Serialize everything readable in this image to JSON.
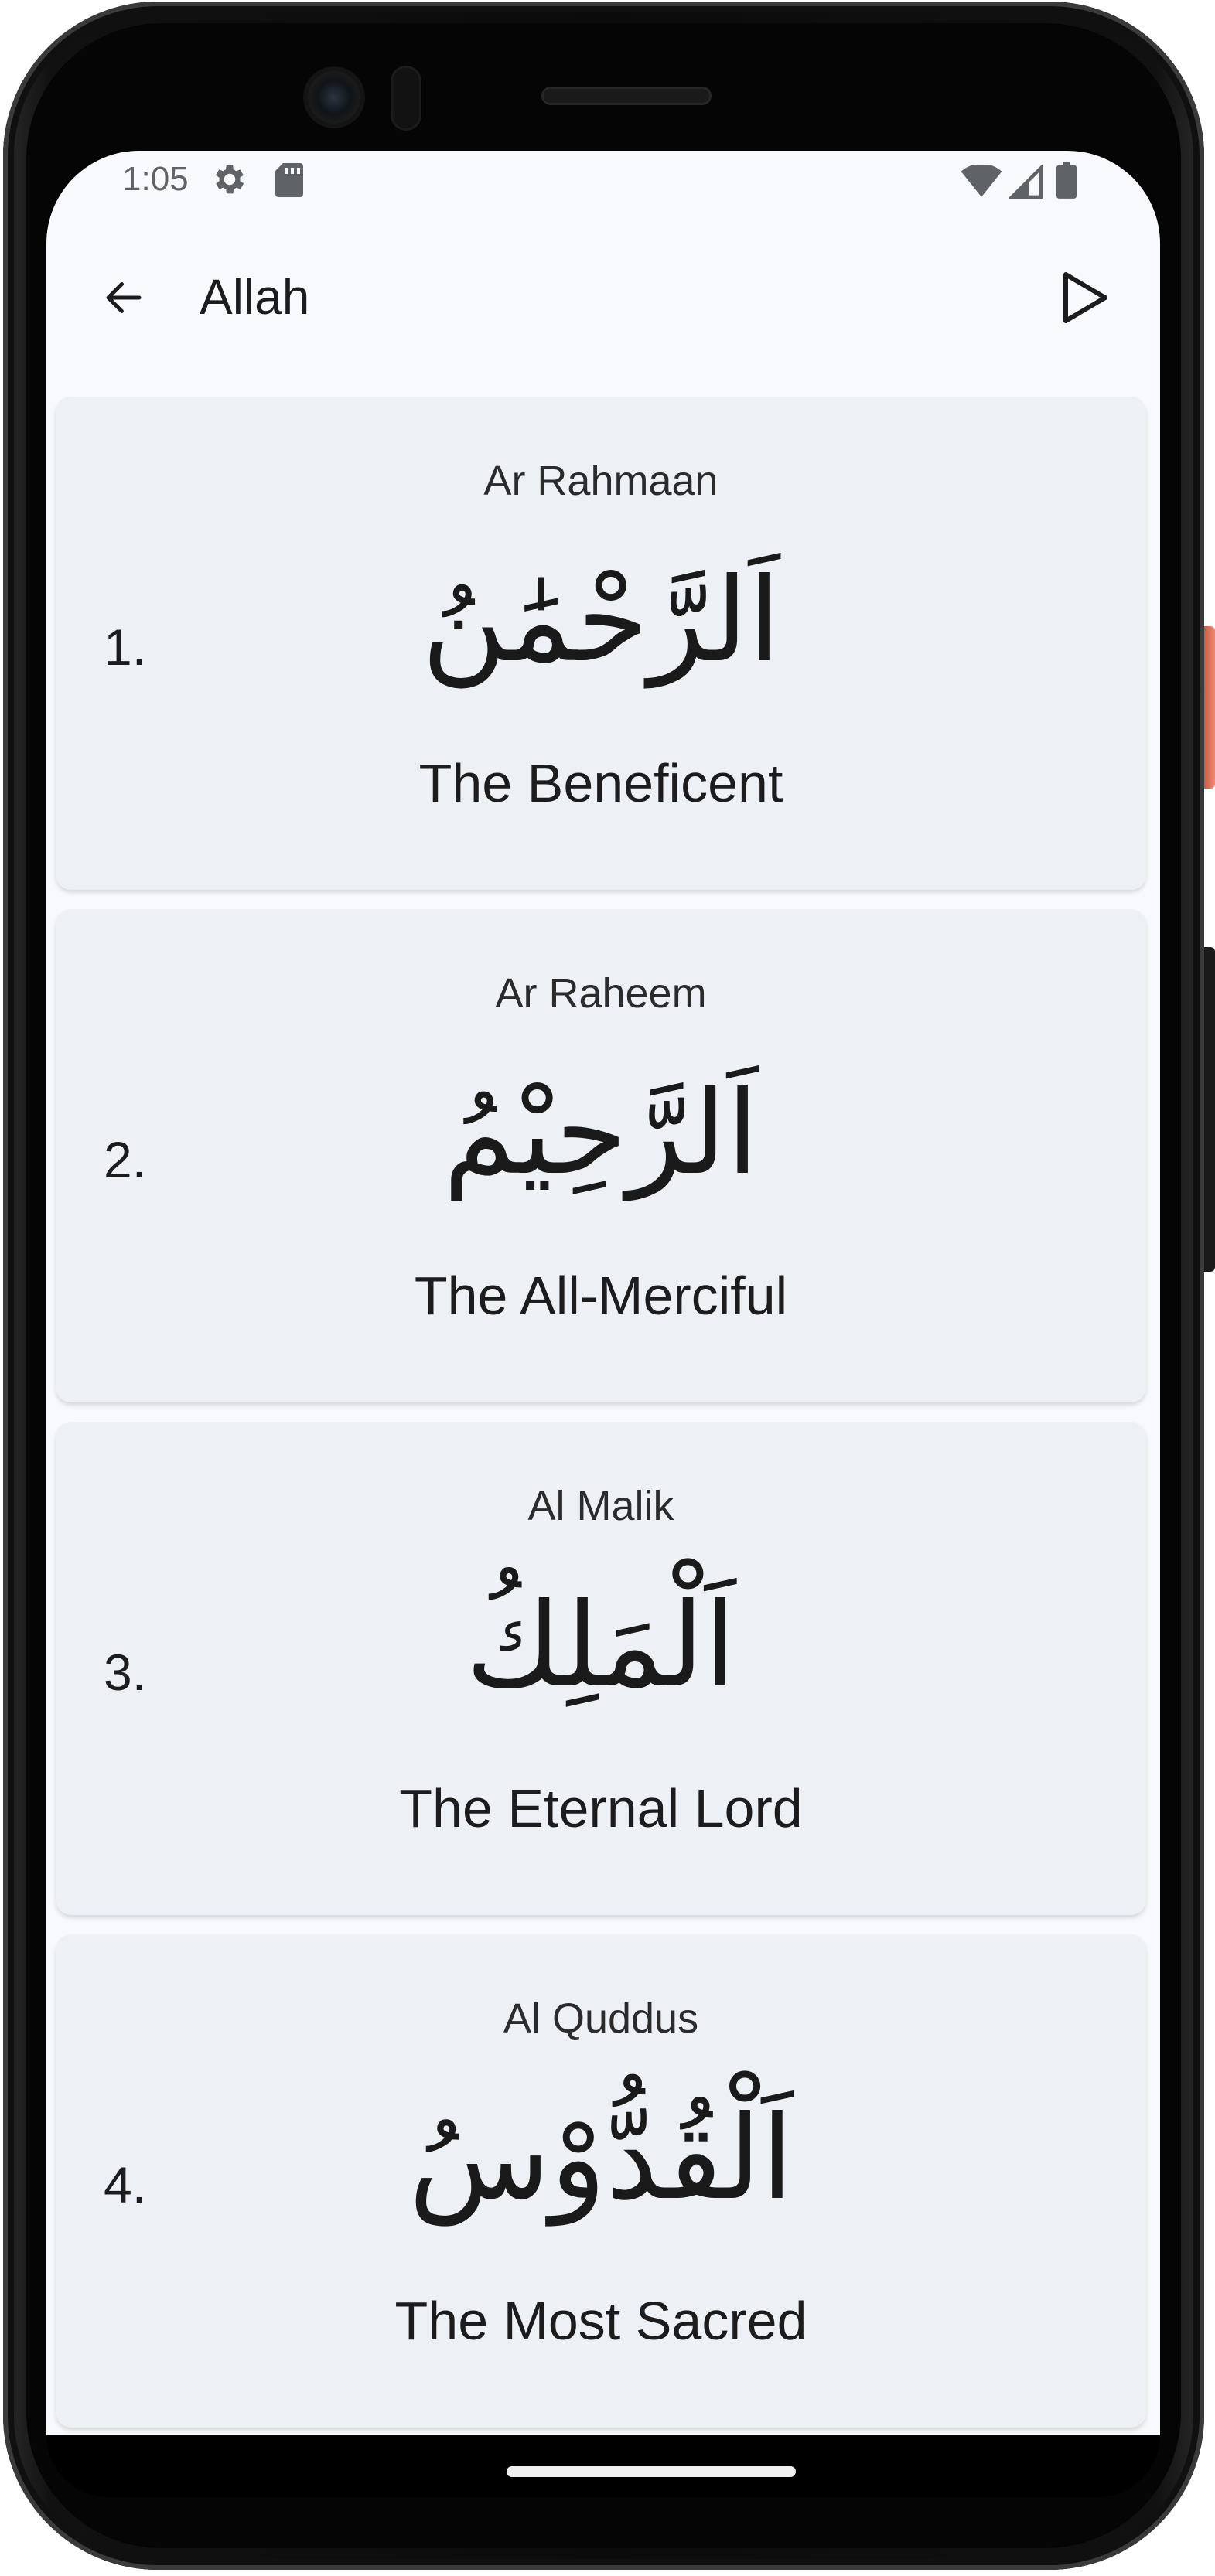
{
  "status_bar": {
    "time": "1:05",
    "icons": [
      "settings-gear-icon",
      "sd-card-icon",
      "wifi-icon",
      "signal-icon",
      "battery-icon"
    ]
  },
  "app_bar": {
    "title": "Allah",
    "back_icon": "arrow-back-icon",
    "play_icon": "play-icon"
  },
  "names": [
    {
      "number": "1.",
      "transliteration": "Ar Rahmaan",
      "arabic": "اَلرَّحْمَٰنُ",
      "meaning": "The Beneficent"
    },
    {
      "number": "2.",
      "transliteration": "Ar Raheem",
      "arabic": "اَلرَّحِيْمُ",
      "meaning": "The All-Merciful"
    },
    {
      "number": "3.",
      "transliteration": "Al Malik",
      "arabic": "اَلْمَلِكُ",
      "meaning": "The Eternal Lord"
    },
    {
      "number": "4.",
      "transliteration": "Al Quddus",
      "arabic": "اَلْقُدُّوْسُ",
      "meaning": "The Most Sacred"
    }
  ],
  "colors": {
    "screen_background": "#f7f9fc",
    "card_background": "#edf1f5",
    "text_primary": "#1c1c1e",
    "power_button": "#f08b74"
  }
}
